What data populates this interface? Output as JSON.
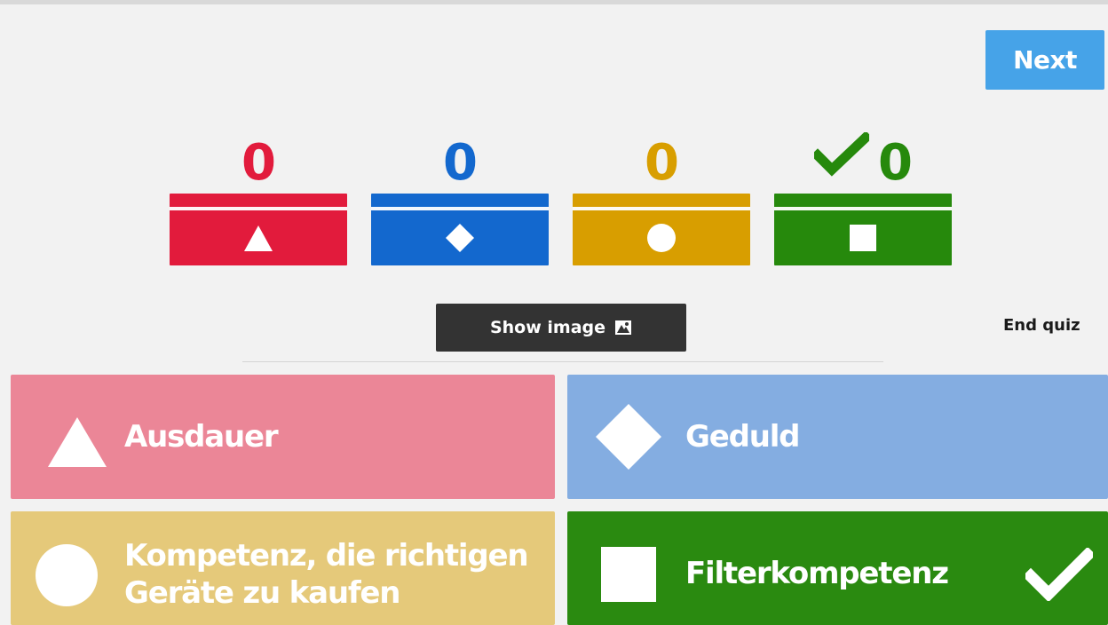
{
  "header": {
    "next_label": "Next"
  },
  "scores": [
    {
      "value": "0",
      "shape": "triangle-icon",
      "color": "#e21b3c",
      "correct": false
    },
    {
      "value": "0",
      "shape": "diamond-icon",
      "color": "#1368ce",
      "correct": false
    },
    {
      "value": "0",
      "shape": "circle-icon",
      "color": "#d89e00",
      "correct": false
    },
    {
      "value": "0",
      "shape": "square-icon",
      "color": "#26890c",
      "correct": true
    }
  ],
  "controls": {
    "show_image_label": "Show image",
    "end_quiz_label": "End quiz"
  },
  "answers": [
    {
      "label": "Ausdauer",
      "shape": "triangle-icon",
      "color": "#eb8697",
      "correct": false
    },
    {
      "label": "Geduld",
      "shape": "diamond-icon",
      "color": "#84ade1",
      "correct": false
    },
    {
      "label_line1": "Kompetenz, die richtigen",
      "label_line2": "Geräte zu kaufen",
      "shape": "circle-icon",
      "color": "#e5c97a",
      "correct": false
    },
    {
      "label": "Filterkompetenz",
      "shape": "square-icon",
      "color": "#2a8a10",
      "correct": true
    }
  ]
}
